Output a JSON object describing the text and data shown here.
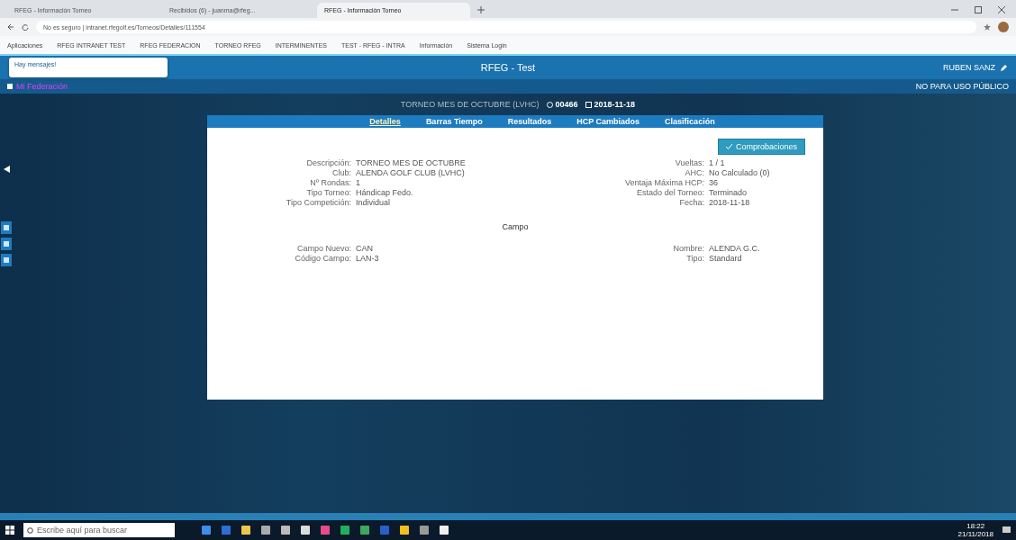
{
  "browser": {
    "tabs": [
      {
        "title": "RFEG - Información Torneo",
        "selected": false
      },
      {
        "title": "Recibidos (6) - juanma@rfeg...",
        "selected": false
      },
      {
        "title": "RFEG - Información Torneo",
        "selected": true
      }
    ],
    "address": "No es seguro | intranet.rfegolf.es/Torneos/Detalles/111554",
    "bookmarks": [
      "Aplicaciones",
      "RFEG INTRANET TEST",
      "RFEG FEDERACION",
      "TORNEO RFEG",
      "INTERMINENTES",
      "TEST - RFEG - INTRA",
      "Información",
      "Sistema Login"
    ]
  },
  "header": {
    "tooltip": "Hay mensajes!",
    "title": "RFEG - Test",
    "user": "RUBEN SANZ",
    "menu_link": "Mi Federación",
    "notice": "NO PARA USO PÚBLICO"
  },
  "tournament": {
    "name": "TORNEO MES DE OCTUBRE (LVHC)",
    "code": "00466",
    "date": "2018-11-18"
  },
  "tabs": [
    {
      "label": "Detalles",
      "selected": true
    },
    {
      "label": "Barras Tiempo",
      "selected": false
    },
    {
      "label": "Resultados",
      "selected": false
    },
    {
      "label": "HCP Cambiados",
      "selected": false
    },
    {
      "label": "Clasificación",
      "selected": false
    }
  ],
  "action_button": "Comprobaciones",
  "details_left": [
    {
      "label": "Descripción:",
      "value": "TORNEO MES DE OCTUBRE"
    },
    {
      "label": "Club:",
      "value": "ALENDA GOLF CLUB (LVHC)"
    },
    {
      "label": "Nº Rondas:",
      "value": "1"
    },
    {
      "label": "Tipo Torneo:",
      "value": "Hándicap Fedo."
    },
    {
      "label": "Tipo Competición:",
      "value": "Individual"
    }
  ],
  "details_right": [
    {
      "label": "Vueltas:",
      "value": "1 / 1"
    },
    {
      "label": "AHC:",
      "value": "No Calculado (0)"
    },
    {
      "label": "Ventaja Máxima HCP:",
      "value": "36"
    },
    {
      "label": "Estado del Torneo:",
      "value": "Terminado"
    },
    {
      "label": "Fecha:",
      "value": "2018-11-18"
    }
  ],
  "section_title": "Campo",
  "course_left": [
    {
      "label": "Campo Nuevo:",
      "value": "CAN"
    },
    {
      "label": "Código Campo:",
      "value": "LAN-3"
    }
  ],
  "course_right": [
    {
      "label": "Nombre:",
      "value": "ALENDA G.C."
    },
    {
      "label": "Tipo:",
      "value": "Standard"
    }
  ],
  "taskbar": {
    "search_placeholder": "Escribe aquí para buscar",
    "time": "18:22",
    "date": "21/11/2018"
  }
}
